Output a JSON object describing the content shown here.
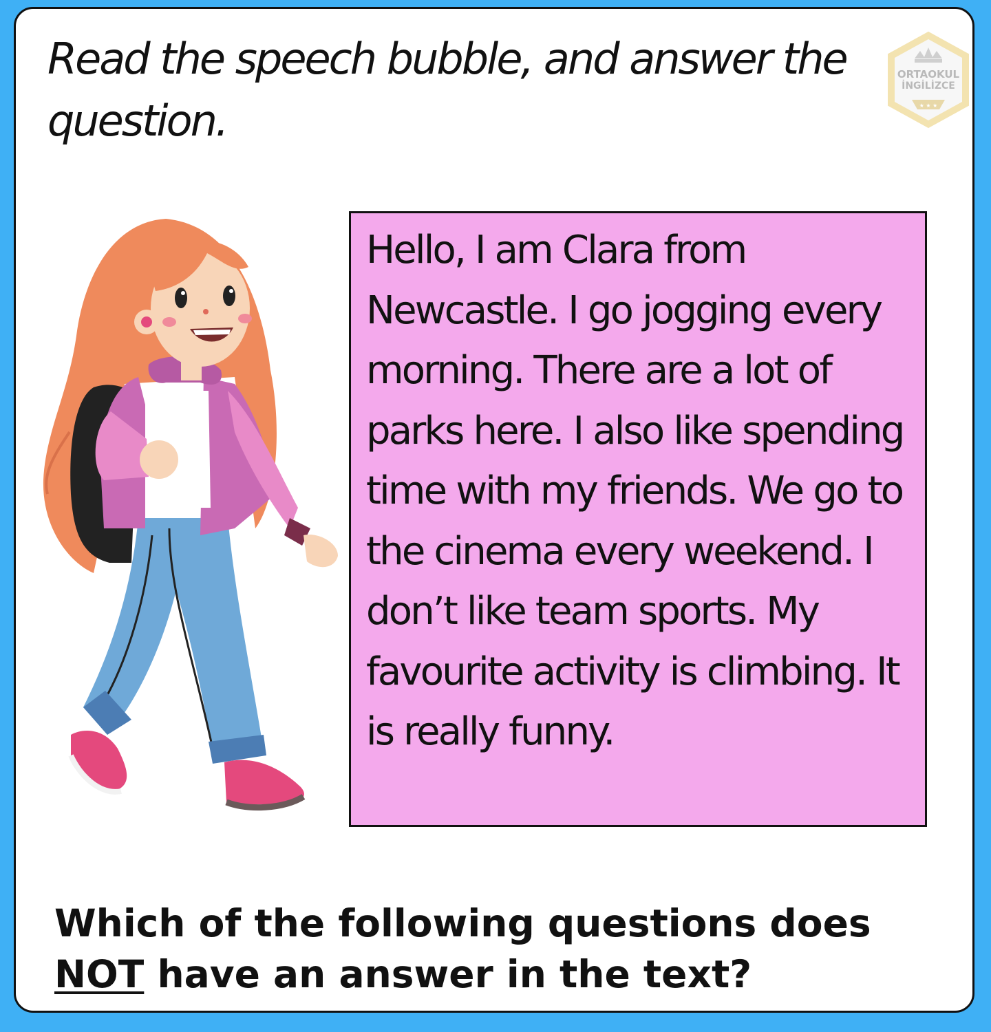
{
  "instruction": "Read the speech bubble, and answer the question.",
  "logo": {
    "line1": "ORTAOKUL",
    "line2": "İNGİLİZCE",
    "colors": {
      "badge": "#f3e3b0",
      "inner": "#f7f7f7",
      "text": "#b9b9b9"
    }
  },
  "speech_bubble": {
    "text": "Hello, I am Clara from Newcastle. I go jogging every morning. There are a lot of parks here. I also like spending time with my friends. We go to the cinema every weekend. I don’t like team sports. My favourite activity is climbing. It is really funny.",
    "background": "#f4a9ec"
  },
  "question": {
    "before": "Which of the following questions does ",
    "emphasis": "NOT",
    "after": " have an answer in the text?"
  },
  "colors": {
    "page_border": "#3fb0f5",
    "card": "#ffffff"
  },
  "illustration": {
    "icon": "walking-girl-with-backpack",
    "colors": {
      "hair": "#ef8a5c",
      "jacket": "#c96ab4",
      "jeans": "#6fa9d8",
      "shoes": "#e4497d",
      "backpack": "#222222"
    }
  }
}
